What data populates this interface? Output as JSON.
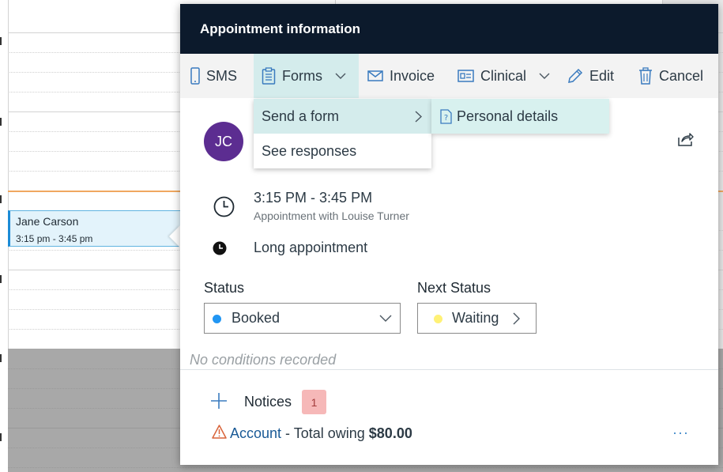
{
  "calendar": {
    "event": {
      "name": "Jane Carson",
      "time": "3:15 pm - 3:45 pm"
    }
  },
  "popup": {
    "title": "Appointment information",
    "toolbar": {
      "sms": "SMS",
      "forms": "Forms",
      "invoice": "Invoice",
      "clinical": "Clinical",
      "edit": "Edit",
      "cancel": "Cancel"
    },
    "forms_menu": {
      "send_form": "Send a form",
      "see_responses": "See responses",
      "submenu_item": "Personal details"
    },
    "patient_initials": "JC",
    "time": {
      "range": "3:15 PM - 3:45 PM",
      "with": "Appointment with Louise Turner"
    },
    "appointment_type": "Long appointment",
    "status": {
      "label": "Status",
      "value": "Booked",
      "color": "#2196f3"
    },
    "next_status": {
      "label": "Next Status",
      "value": "Waiting",
      "color": "#fff176"
    },
    "no_conditions": "No conditions recorded",
    "notices": {
      "label": "Notices",
      "count": "1",
      "item_link": "Account",
      "item_text": " - Total owing ",
      "item_amount": "$80.00"
    }
  },
  "colors": {
    "header_bg": "#0c1a2c",
    "active_bg": "#d4ecec",
    "avatar_bg": "#5c2d91",
    "link": "#1a5a96"
  }
}
